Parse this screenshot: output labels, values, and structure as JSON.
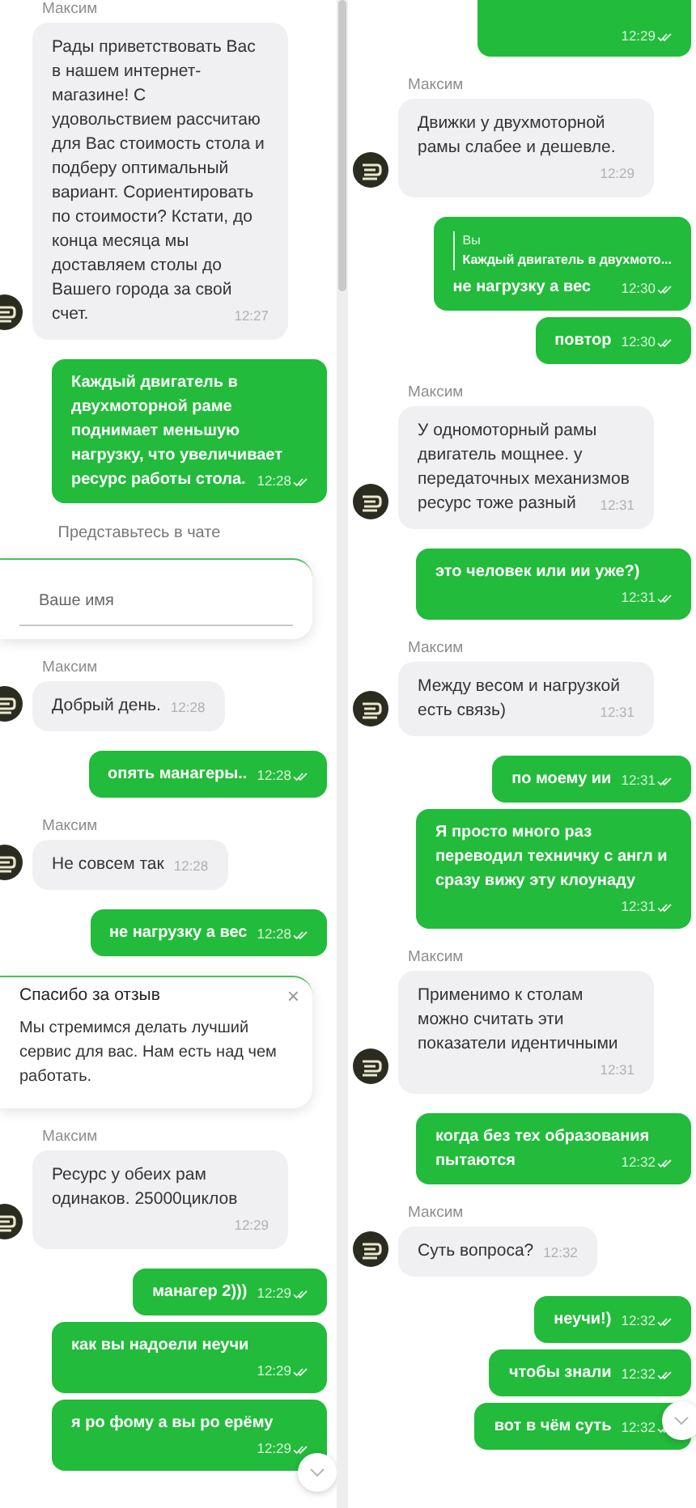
{
  "panes": [
    {
      "scroll_down_button": true,
      "messages": [
        {
          "kind": "incoming",
          "sender": "Максим",
          "text": "Рады приветствовать Вас в нашем интернет-магазине! С удовольствием рассчитаю для Вас стоимость стола и подберу оптимальный вариант.  Сориентировать по стоимости? Кстати, до конца месяца мы доставляем столы до Вашего города за свой счет.",
          "time": "12:27"
        },
        {
          "kind": "outgoing",
          "text": "Каждый двигатель в двухмоторной раме поднимает меньшую нагрузку, что увеличивает ресурс работы стола.",
          "time": "12:28",
          "read": true
        },
        {
          "kind": "note",
          "text": "Представьтесь в чате"
        },
        {
          "kind": "name_form",
          "placeholder": "Ваше имя"
        },
        {
          "kind": "incoming",
          "sender": "Максим",
          "text": "Добрый день.",
          "time": "12:28"
        },
        {
          "kind": "outgoing",
          "text": "опять манагеры..",
          "time": "12:28",
          "read": true
        },
        {
          "kind": "incoming",
          "sender": "Максим",
          "text": "Не совсем так",
          "time": "12:28"
        },
        {
          "kind": "outgoing",
          "text": "не  нагрузку а вес",
          "time": "12:28",
          "read": true
        },
        {
          "kind": "feedback",
          "title": "Спасибо за отзыв",
          "close": "×",
          "text": "Мы стремимся делать лучший сервис для вас. Нам есть над чем работать."
        },
        {
          "kind": "incoming",
          "sender": "Максим",
          "text": "Ресурс у обеих рам одинаков. 25000циклов",
          "time": "12:29"
        },
        {
          "kind": "outgoing",
          "text": "манагер 2)))",
          "time": "12:29",
          "read": true
        },
        {
          "kind": "outgoing",
          "text": "как вы надоели неучи",
          "time": "12:29",
          "read": true
        },
        {
          "kind": "outgoing",
          "text": "я ро фому а вы ро ерёму",
          "time": "12:29",
          "read": true
        }
      ]
    },
    {
      "scroll_down_button": true,
      "messages": [
        {
          "kind": "outgoing",
          "time": "12:29",
          "read": true
        },
        {
          "kind": "incoming",
          "sender": "Максим",
          "text": "Движки у двухмоторной рамы слабее и дешевле.",
          "time": "12:29"
        },
        {
          "kind": "outgoing",
          "quote": {
            "author": "Вы",
            "text": "Каждый двигатель в двухмото..."
          },
          "text": "не нагрузку а вес",
          "time": "12:30",
          "read": true
        },
        {
          "kind": "outgoing",
          "text": "повтор",
          "time": "12:30",
          "read": true
        },
        {
          "kind": "incoming",
          "sender": "Максим",
          "text": "У одномоторный рамы двигатель мощнее. у передаточных механизмов ресурс тоже разный",
          "time": "12:31"
        },
        {
          "kind": "outgoing",
          "text": "это человек или ии уже?)",
          "time": "12:31",
          "read": true
        },
        {
          "kind": "incoming",
          "sender": "Максим",
          "text": "Между весом и нагрузкой есть связь)",
          "time": "12:31"
        },
        {
          "kind": "outgoing",
          "text": "по моему ии",
          "time": "12:31",
          "read": true
        },
        {
          "kind": "outgoing",
          "text": "Я просто много раз переводил техничку с англ и сразу вижу эту клоунаду",
          "time": "12:31",
          "read": true
        },
        {
          "kind": "incoming",
          "sender": "Максим",
          "text": "Применимо к столам можно считать эти показатели идентичными",
          "time": "12:31"
        },
        {
          "kind": "outgoing",
          "text": "когда без тех образования пытаются",
          "time": "12:32",
          "read": true
        },
        {
          "kind": "incoming",
          "sender": "Максим",
          "text": "Суть вопроса?",
          "time": "12:32"
        },
        {
          "kind": "outgoing",
          "text": "неучи!)",
          "time": "12:32",
          "read": true
        },
        {
          "kind": "outgoing",
          "text": "чтобы знали",
          "time": "12:32",
          "read": true
        },
        {
          "kind": "outgoing",
          "text": "вот в чём суть",
          "time": "12:32",
          "read": true
        }
      ]
    }
  ]
}
